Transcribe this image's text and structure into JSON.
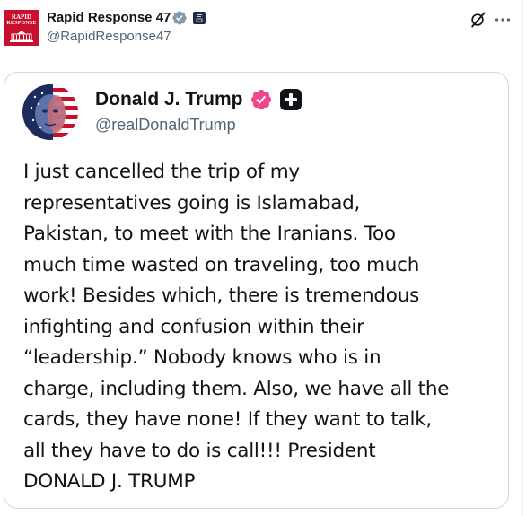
{
  "header": {
    "logo_line1": "RAPID",
    "logo_line2": "RESPONSE",
    "display_name": "Rapid Response 47",
    "handle": "@RapidResponse47"
  },
  "quoted_post": {
    "display_name": "Donald J. Trump",
    "handle": "@realDonaldTrump",
    "body_lines": [
      "I just cancelled the trip of my",
      "representatives going is Islamabad,",
      "Pakistan, to meet with the Iranians. Too",
      "much time wasted on traveling, too much",
      "work! Besides which, there is tremendous",
      "infighting and confusion within their",
      "“leadership.” Nobody knows who is in",
      "charge, including them. Also, we have all the",
      "cards, they have none! If they want to talk,",
      "all they have to do is call!!! President",
      "DONALD J. TRUMP"
    ]
  },
  "icons": {
    "account_verified": "gray-verified-badge-icon",
    "affiliate": "affiliate-badge-icon",
    "grok": "grok-icon",
    "more": "more-dots-icon",
    "quoted_verified": "pink-verified-badge-icon",
    "platform": "plus-icon"
  },
  "colors": {
    "brand_red": "#c8102e",
    "verified_gray": "#829aab",
    "verified_pink": "#f0468c",
    "text": "#0f1419",
    "secondary_text": "#536471",
    "border": "#cfd9de"
  }
}
